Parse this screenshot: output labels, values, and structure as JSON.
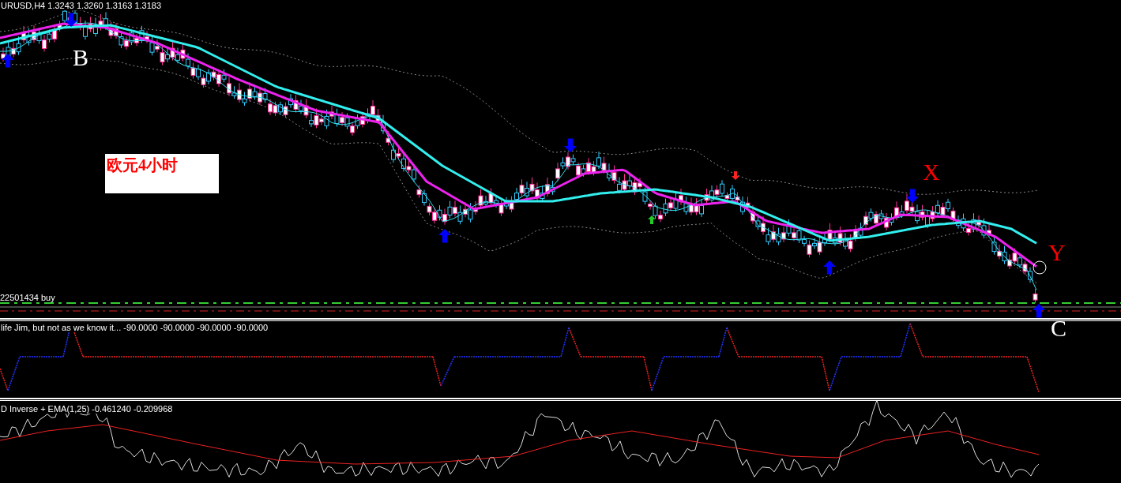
{
  "main_chart": {
    "header": "URUSD,H4  1.3243 1.3260 1.3163 1.3183",
    "annotations": [
      {
        "text": "B",
        "color": "#ffffff"
      },
      {
        "text": "X",
        "color": "#ff0000"
      },
      {
        "text": "Y",
        "color": "#ff0000"
      },
      {
        "text": "C",
        "color": "#ffffff"
      }
    ],
    "note": "欧元4小时",
    "order_label": "22501434 buy"
  },
  "indicator_1": {
    "label": "life Jim, but not as we know it...  -90.0000 -90.0000 -90.0000 -90.0000"
  },
  "indicator_2": {
    "label": "D Inverse + EMA(1,25) -0.461240 -0.209968"
  }
}
